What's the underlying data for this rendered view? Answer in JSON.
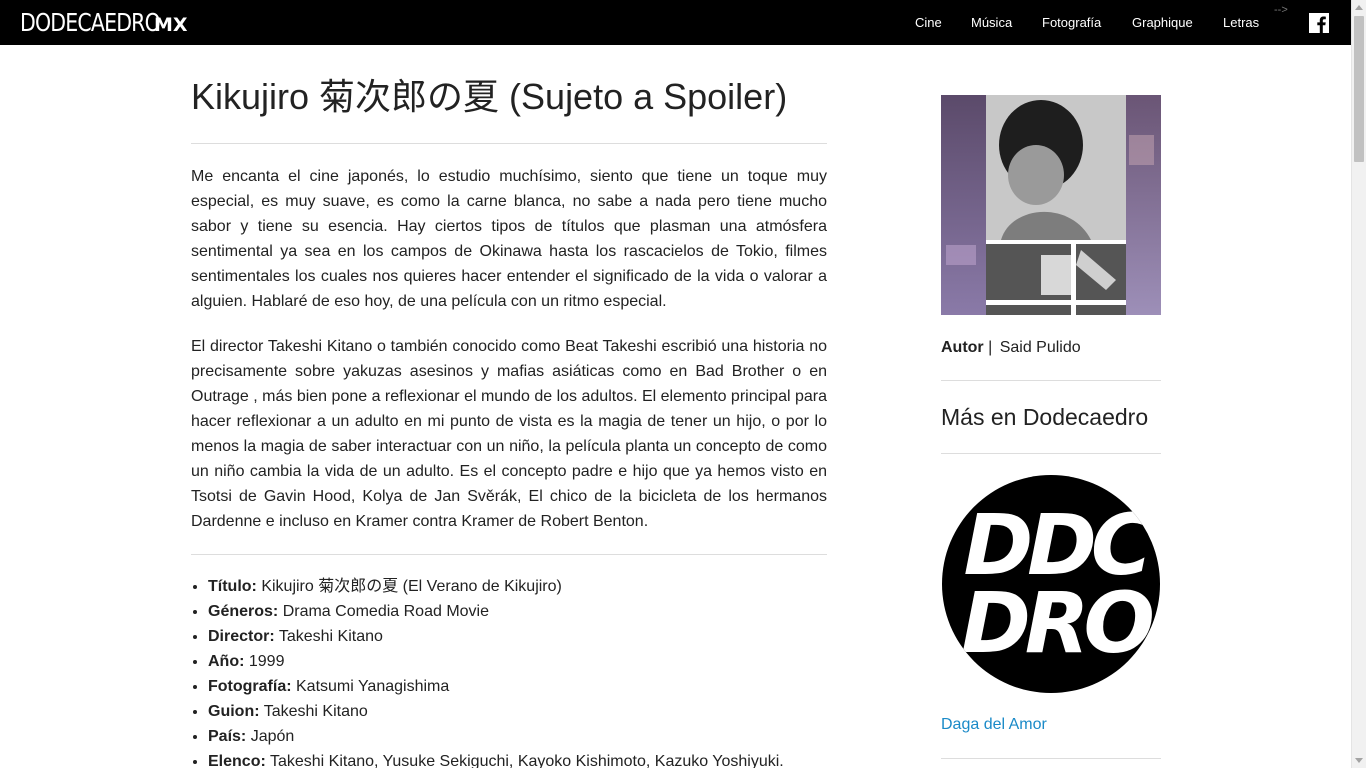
{
  "site": {
    "logo_main": "DODECAEDRO",
    "logo_suffix": "MX",
    "nav": [
      "Cine",
      "Música",
      "Fotografía",
      "Graphique",
      "Letras"
    ],
    "stray_text": "-->",
    "social_icon": "facebook-icon"
  },
  "article": {
    "title": "Kikujiro 菊次郎の夏 (Sujeto a Spoiler)",
    "paragraphs": [
      "Me encanta el cine japonés, lo estudio muchísimo, siento que tiene un toque muy especial, es muy suave, es como la carne blanca, no sabe a nada pero tiene mucho sabor y tiene su esencia. Hay ciertos tipos de títulos que plasman una atmósfera sentimental ya sea en los campos de Okinawa hasta los rascacielos de Tokio, filmes sentimentales los cuales nos quieres hacer entender el significado de la vida o valorar a alguien. Hablaré de eso hoy, de una película con un ritmo especial.",
      "El director Takeshi Kitano o también conocido como Beat Takeshi escribió una historia no precisamente sobre yakuzas asesinos y mafias asiáticas como en Bad Brother o en Outrage , más bien pone a reflexionar el mundo de los adultos. El elemento principal para hacer reflexionar a un adulto en mi punto de vista es la magia de tener un hijo, o por lo menos la magia de saber interactuar con un niño, la película planta un concepto de como un niño cambia la vida de un adulto. Es el concepto padre e hijo que ya hemos visto en Tsotsi de Gavin Hood, Kolya de Jan Svěrák, El chico de la bicicleta de los hermanos Dardenne e incluso en Kramer contra Kramer de Robert Benton."
    ],
    "specs": [
      {
        "label": "Título:",
        "value": " Kikujiro 菊次郎の夏 (El Verano de Kikujiro)"
      },
      {
        "label": "Géneros:",
        "value": " Drama Comedia Road Movie"
      },
      {
        "label": "Director:",
        "value": " Takeshi Kitano"
      },
      {
        "label": "Año:",
        "value": " 1999"
      },
      {
        "label": "Fotografía:",
        "value": " Katsumi Yanagishima"
      },
      {
        "label": "Guion:",
        "value": " Takeshi Kitano"
      },
      {
        "label": "País:",
        "value": " Japón"
      },
      {
        "label": "Elenco:",
        "value": " Takeshi Kitano, Yusuke Sekiguchi, Kayoko Kishimoto, Kazuko Yoshiyuki."
      }
    ]
  },
  "sidebar": {
    "author_label": "Autor",
    "author_sep": " | ",
    "author_name": "Said Pulido",
    "more_heading": "Más en Dodecaedro",
    "related_logo_text": [
      "DDC",
      "DRO"
    ],
    "related_title": "Daga del Amor"
  },
  "colors": {
    "topbar": "#000000",
    "link": "#1a8ac8",
    "divider": "#dddddd",
    "text": "#222222"
  }
}
